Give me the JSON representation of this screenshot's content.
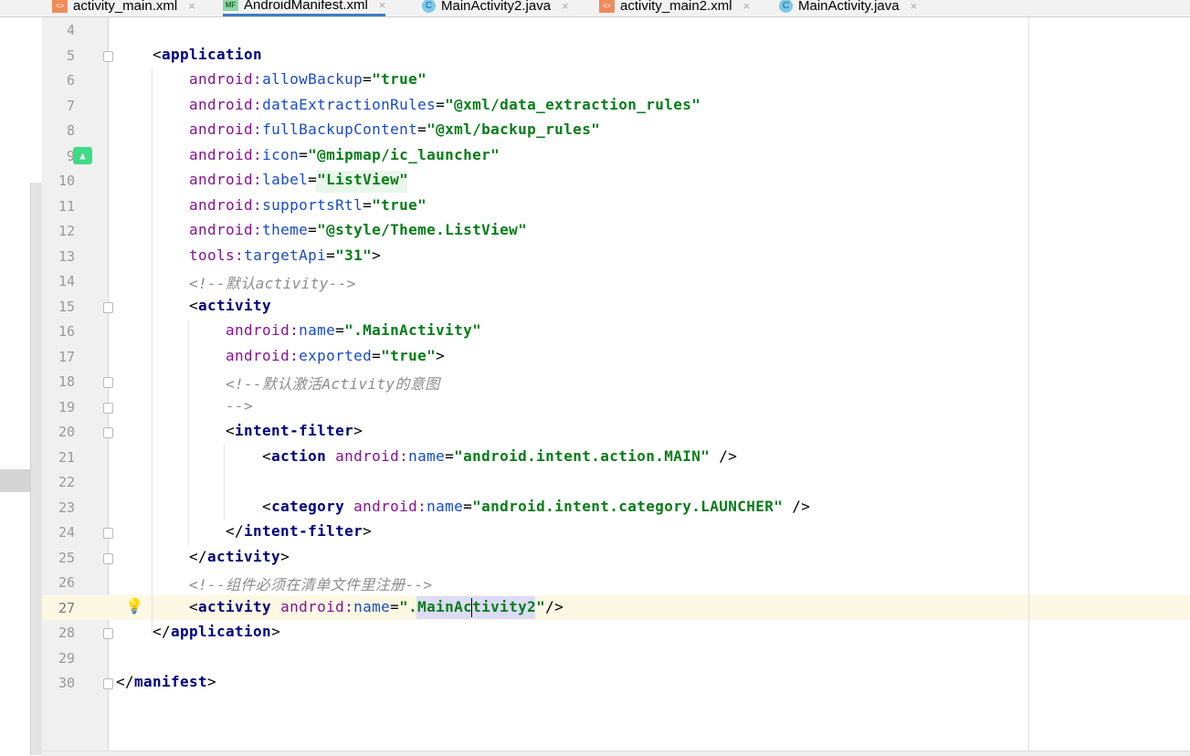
{
  "tabs": [
    {
      "label": "activity_main.xml",
      "icon": "xml-file-icon",
      "active": false
    },
    {
      "label": "AndroidManifest.xml",
      "icon": "manifest-file-icon",
      "active": true
    },
    {
      "label": "MainActivity2.java",
      "icon": "java-class-icon",
      "active": false
    },
    {
      "label": "activity_main2.xml",
      "icon": "xml-file-icon",
      "active": false
    },
    {
      "label": "MainActivity.java",
      "icon": "java-class-icon",
      "active": false
    }
  ],
  "current_line": 27,
  "lines": [
    {
      "n": "4",
      "tokens": []
    },
    {
      "n": "5",
      "tokens": [
        [
          "p",
          "    <"
        ],
        [
          "t",
          "application"
        ]
      ]
    },
    {
      "n": "6",
      "tokens": [
        [
          "p",
          "        "
        ],
        [
          "ns",
          "android:"
        ],
        [
          "an",
          "allowBackup"
        ],
        [
          "p",
          "="
        ],
        [
          "v",
          "\"true\""
        ]
      ]
    },
    {
      "n": "7",
      "tokens": [
        [
          "p",
          "        "
        ],
        [
          "ns",
          "android:"
        ],
        [
          "an",
          "dataExtractionRules"
        ],
        [
          "p",
          "="
        ],
        [
          "v",
          "\"@xml/data_extraction_rules\""
        ]
      ]
    },
    {
      "n": "8",
      "tokens": [
        [
          "p",
          "        "
        ],
        [
          "ns",
          "android:"
        ],
        [
          "an",
          "fullBackupContent"
        ],
        [
          "p",
          "="
        ],
        [
          "v",
          "\"@xml/backup_rules\""
        ]
      ]
    },
    {
      "n": "9",
      "tokens": [
        [
          "p",
          "        "
        ],
        [
          "ns",
          "android:"
        ],
        [
          "an",
          "icon"
        ],
        [
          "p",
          "="
        ],
        [
          "v",
          "\"@mipmap/ic_launcher\""
        ]
      ]
    },
    {
      "n": "10",
      "tokens": [
        [
          "p",
          "        "
        ],
        [
          "ns",
          "android:"
        ],
        [
          "an",
          "label"
        ],
        [
          "p",
          "="
        ],
        [
          "v",
          "\"ListView\""
        ]
      ]
    },
    {
      "n": "11",
      "tokens": [
        [
          "p",
          "        "
        ],
        [
          "ns",
          "android:"
        ],
        [
          "an",
          "supportsRtl"
        ],
        [
          "p",
          "="
        ],
        [
          "v",
          "\"true\""
        ]
      ]
    },
    {
      "n": "12",
      "tokens": [
        [
          "p",
          "        "
        ],
        [
          "ns",
          "android:"
        ],
        [
          "an",
          "theme"
        ],
        [
          "p",
          "="
        ],
        [
          "v",
          "\"@style/Theme.ListView\""
        ]
      ]
    },
    {
      "n": "13",
      "tokens": [
        [
          "p",
          "        "
        ],
        [
          "ns",
          "tools:"
        ],
        [
          "an",
          "targetApi"
        ],
        [
          "p",
          "="
        ],
        [
          "v",
          "\"31\""
        ],
        [
          "p",
          ">"
        ]
      ]
    },
    {
      "n": "14",
      "tokens": [
        [
          "p",
          "        "
        ],
        [
          "c",
          "<!--默认activity-->"
        ]
      ]
    },
    {
      "n": "15",
      "tokens": [
        [
          "p",
          "        <"
        ],
        [
          "t",
          "activity"
        ]
      ]
    },
    {
      "n": "16",
      "tokens": [
        [
          "p",
          "            "
        ],
        [
          "ns",
          "android:"
        ],
        [
          "an",
          "name"
        ],
        [
          "p",
          "="
        ],
        [
          "v",
          "\".MainActivity\""
        ]
      ]
    },
    {
      "n": "17",
      "tokens": [
        [
          "p",
          "            "
        ],
        [
          "ns",
          "android:"
        ],
        [
          "an",
          "exported"
        ],
        [
          "p",
          "="
        ],
        [
          "v",
          "\"true\""
        ],
        [
          "p",
          ">"
        ]
      ]
    },
    {
      "n": "18",
      "tokens": [
        [
          "p",
          "            "
        ],
        [
          "c",
          "<!--默认激活Activity的意图"
        ]
      ]
    },
    {
      "n": "19",
      "tokens": [
        [
          "p",
          "            "
        ],
        [
          "c",
          "-->"
        ]
      ]
    },
    {
      "n": "20",
      "tokens": [
        [
          "p",
          "            <"
        ],
        [
          "t",
          "intent-filter"
        ],
        [
          "p",
          ">"
        ]
      ]
    },
    {
      "n": "21",
      "tokens": [
        [
          "p",
          "                <"
        ],
        [
          "t",
          "action "
        ],
        [
          "ns",
          "android:"
        ],
        [
          "an",
          "name"
        ],
        [
          "p",
          "="
        ],
        [
          "v",
          "\"android.intent.action.MAIN\""
        ],
        [
          "p",
          " />"
        ]
      ]
    },
    {
      "n": "22",
      "tokens": []
    },
    {
      "n": "23",
      "tokens": [
        [
          "p",
          "                <"
        ],
        [
          "t",
          "category "
        ],
        [
          "ns",
          "android:"
        ],
        [
          "an",
          "name"
        ],
        [
          "p",
          "="
        ],
        [
          "v",
          "\"android.intent.category.LAUNCHER\""
        ],
        [
          "p",
          " />"
        ]
      ]
    },
    {
      "n": "24",
      "tokens": [
        [
          "p",
          "            </"
        ],
        [
          "t",
          "intent-filter"
        ],
        [
          "p",
          ">"
        ]
      ]
    },
    {
      "n": "25",
      "tokens": [
        [
          "p",
          "        </"
        ],
        [
          "t",
          "activity"
        ],
        [
          "p",
          ">"
        ]
      ]
    },
    {
      "n": "26",
      "tokens": [
        [
          "p",
          "        "
        ],
        [
          "c",
          "<!--组件必须在清单文件里注册-->"
        ]
      ]
    },
    {
      "n": "27",
      "tokens": [
        [
          "p",
          "        <"
        ],
        [
          "t",
          "activity "
        ],
        [
          "ns",
          "android:"
        ],
        [
          "an",
          "name"
        ],
        [
          "p",
          "="
        ],
        [
          "v",
          "\".MainActivity2\""
        ],
        [
          "p",
          "/>"
        ]
      ]
    },
    {
      "n": "28",
      "tokens": [
        [
          "p",
          "    </"
        ],
        [
          "t",
          "application"
        ],
        [
          "p",
          ">"
        ]
      ]
    },
    {
      "n": "29",
      "tokens": []
    },
    {
      "n": "30",
      "tokens": [
        [
          "p",
          "</"
        ],
        [
          "t",
          "manifest"
        ],
        [
          "p",
          ">"
        ]
      ]
    }
  ],
  "colors": {
    "accent": "#3d7ac8",
    "current_line": "#fdf8e3"
  }
}
